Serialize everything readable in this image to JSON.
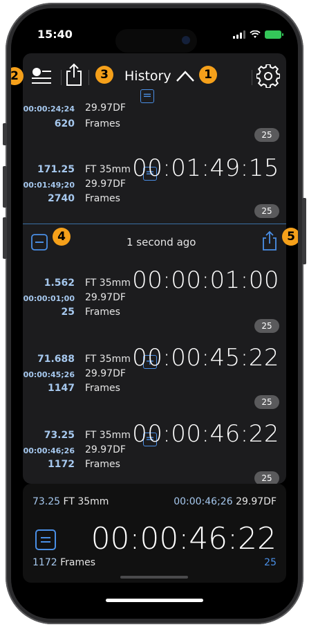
{
  "status_bar": {
    "time": "15:40"
  },
  "header": {
    "title": "History",
    "badges": {
      "history_toggle": "1",
      "list_toggle": "2",
      "share_all": "3",
      "delete_group": "4",
      "share_group": "5"
    }
  },
  "history": {
    "partial_entry": {
      "timecode_label": "00:00:24;24",
      "rate": "29.97DF",
      "frames": "620",
      "frames_label": "Frames",
      "fps": "25"
    },
    "entry_1": {
      "feet": "171.25",
      "feet_unit": "FT 35mm",
      "timecode_label": "00:01:49;20",
      "rate": "29.97DF",
      "frames": "2740",
      "frames_label": "Frames",
      "op": "=",
      "timecode": "00:01:49:15",
      "fps": "25"
    },
    "group_time": "1 second ago",
    "entry_2": {
      "feet": "1.562",
      "feet_unit": "FT 35mm",
      "timecode_label": "00:00:01;00",
      "rate": "29.97DF",
      "frames": "25",
      "frames_label": "Frames",
      "timecode": "00:00:01:00",
      "fps": "25"
    },
    "entry_3": {
      "feet": "71.688",
      "feet_unit": "FT 35mm",
      "timecode_label": "00:00:45;26",
      "rate": "29.97DF",
      "frames": "1147",
      "frames_label": "Frames",
      "op": "+",
      "timecode": "00:00:45:22",
      "fps": "25"
    },
    "entry_4": {
      "feet": "73.25",
      "feet_unit": "FT 35mm",
      "timecode_label": "00:00:46;26",
      "rate": "29.97DF",
      "frames": "1172",
      "frames_label": "Frames",
      "op": "=",
      "timecode": "00:00:46:22",
      "fps": "25"
    }
  },
  "result": {
    "feet": "73.25",
    "feet_unit": "FT 35mm",
    "timecode_label": "00:00:46;26",
    "rate": "29.97DF",
    "op": "=",
    "timecode": "00:00:46:22",
    "frames": "1172",
    "frames_label": "Frames",
    "fps": "25"
  },
  "colors": {
    "accent": "#4a8fe6",
    "badge": "#f5a01a",
    "label_blue": "#a6c8ee"
  },
  "icons": [
    "list-toggle-icon",
    "share-icon",
    "chevron-up-icon",
    "gear-icon",
    "minus-square-icon",
    "equals-square-icon",
    "plus-square-icon"
  ]
}
